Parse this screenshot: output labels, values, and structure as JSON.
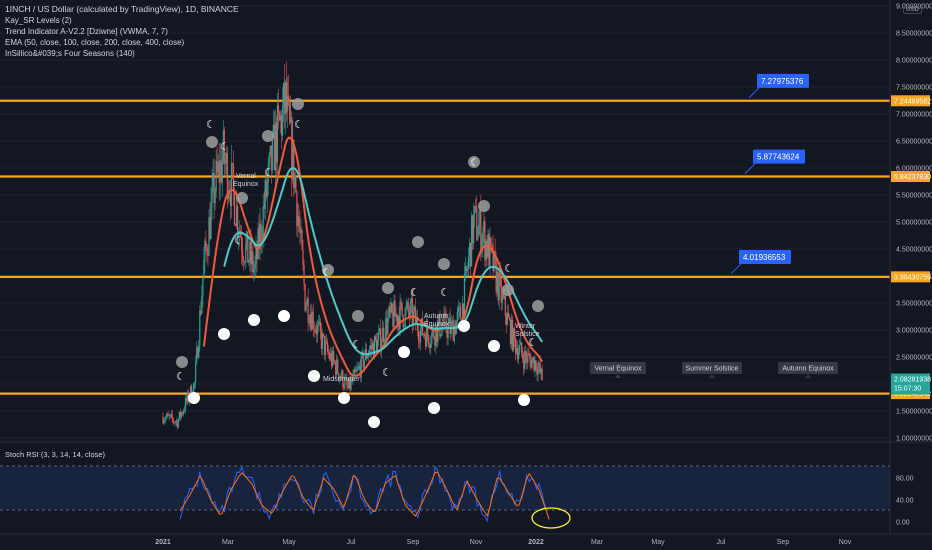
{
  "legend": {
    "title": "1INCH / US Dollar (calculated by TradingView), 1D, BINANCE",
    "line2": "Kay_SR Levels (2)",
    "line3": "Trend Indicator A-V2.2 [Dziwne] (VWMA, 7, 7)",
    "line4": "EMA (50, close, 100, close, 200, close, 400, close)",
    "line5": "InSillico&#039;s Four Seasons (140)"
  },
  "axis": {
    "currency": "USD",
    "price_ticks": [
      "9.00000000",
      "8.50000000",
      "8.00000000",
      "7.50000000",
      "7.00000000",
      "6.50000000",
      "6.00000000",
      "5.50000000",
      "5.00000000",
      "4.50000000",
      "4.00000000",
      "3.50000000",
      "3.00000000",
      "2.50000000",
      "1.50000000",
      "1.00000000"
    ],
    "last_price": "2.08281938",
    "countdown": "15:07:30",
    "months": [
      "2021",
      "Mar",
      "May",
      "Jul",
      "Sep",
      "Nov",
      "2022",
      "Mar",
      "May",
      "Jul",
      "Sep",
      "Nov"
    ],
    "rsi_ticks": [
      "80.00",
      "40.00",
      "0.00"
    ]
  },
  "sr_levels": [
    {
      "value": 7.24469582,
      "label": "7.24469582"
    },
    {
      "value": 5.8423783,
      "label": "5.84237830"
    },
    {
      "value": 3.98430759,
      "label": "3.98430759"
    },
    {
      "value": 1.82240142,
      "label": "1.82240142"
    }
  ],
  "callouts": [
    {
      "value": 7.27975376,
      "label": "7.27975376"
    },
    {
      "value": 5.87743624,
      "label": "5.87743624"
    },
    {
      "value": 4.01936553,
      "label": "4.01936553"
    }
  ],
  "annotations": {
    "vernal_1": "Vernal",
    "vernal_2": "Equinox",
    "midsummer": "Midsummer",
    "autumn_1": "Autumn",
    "autumn_2": "Equinox",
    "winter_1": "Winter",
    "winter_2": "Solstice"
  },
  "future_labels": [
    "Vernal Equinox",
    "Summer Solstice",
    "Autumn Equinox"
  ],
  "rsi_label": "Stoch RSI (3, 3, 14, 14, close)",
  "colors": {
    "background": "#131722",
    "sr_line": "#f5a623",
    "callout": "#2962ff",
    "ema_red": "#f05a3c",
    "ema_teal": "#4ec9c6",
    "candle_up": "#26a69a",
    "candle_down": "#ef5350",
    "rsi_k": "#2962ff",
    "rsi_d": "#ff6d00",
    "last_price_bg": "#26a69a",
    "circle_highlight": "#ffeb3b"
  },
  "chart_data": {
    "type": "line",
    "title": "1INCH / US Dollar (calculated by TradingView), 1D, BINANCE",
    "ylabel": "USD",
    "ylim": [
      1.0,
      9.0
    ],
    "x_ticks": [
      "2021",
      "Mar",
      "May",
      "Jul",
      "Sep",
      "Nov",
      "2022",
      "Mar",
      "May",
      "Jul",
      "Sep",
      "Nov"
    ],
    "series": [
      {
        "name": "1INCH / US Dollar",
        "x": [
          "2021-01-01",
          "2021-01-15",
          "2021-02-01",
          "2021-02-10",
          "2021-02-20",
          "2021-03-01",
          "2021-03-10",
          "2021-03-20",
          "2021-04-01",
          "2021-04-10",
          "2021-04-20",
          "2021-05-01",
          "2021-05-10",
          "2021-05-20",
          "2021-06-01",
          "2021-06-10",
          "2021-06-20",
          "2021-07-01",
          "2021-07-10",
          "2021-07-20",
          "2021-08-01",
          "2021-08-10",
          "2021-08-20",
          "2021-09-01",
          "2021-09-10",
          "2021-09-20",
          "2021-10-01",
          "2021-10-10",
          "2021-10-20",
          "2021-11-01",
          "2021-11-10",
          "2021-11-20",
          "2021-12-01",
          "2021-12-10",
          "2021-12-20",
          "2022-01-01",
          "2022-01-07"
        ],
        "values": [
          1.4,
          1.3,
          2.0,
          4.2,
          5.6,
          6.2,
          5.6,
          4.6,
          4.1,
          5.3,
          6.4,
          7.2,
          5.8,
          3.6,
          3.0,
          2.6,
          2.3,
          1.9,
          2.2,
          2.6,
          2.8,
          3.2,
          3.3,
          3.3,
          3.0,
          2.9,
          3.1,
          3.0,
          3.3,
          5.0,
          4.8,
          4.2,
          3.4,
          2.8,
          2.5,
          2.4,
          2.1
        ]
      }
    ],
    "sr_levels": [
      7.24469582,
      5.8423783,
      3.98430759,
      1.82240142
    ],
    "stoch_rsi": {
      "name": "Stoch RSI (3, 3, 14, 14, close)",
      "ylim": [
        0,
        100
      ],
      "reference_lines": [
        80,
        20
      ],
      "values": [
        20,
        50,
        85,
        40,
        10,
        60,
        90,
        70,
        30,
        15,
        55,
        88,
        45,
        20,
        80,
        60,
        25,
        90,
        40,
        15,
        70,
        85,
        30,
        10,
        50,
        95,
        60,
        20,
        75,
        40,
        10,
        85,
        55,
        25,
        90,
        60,
        5
      ]
    }
  }
}
